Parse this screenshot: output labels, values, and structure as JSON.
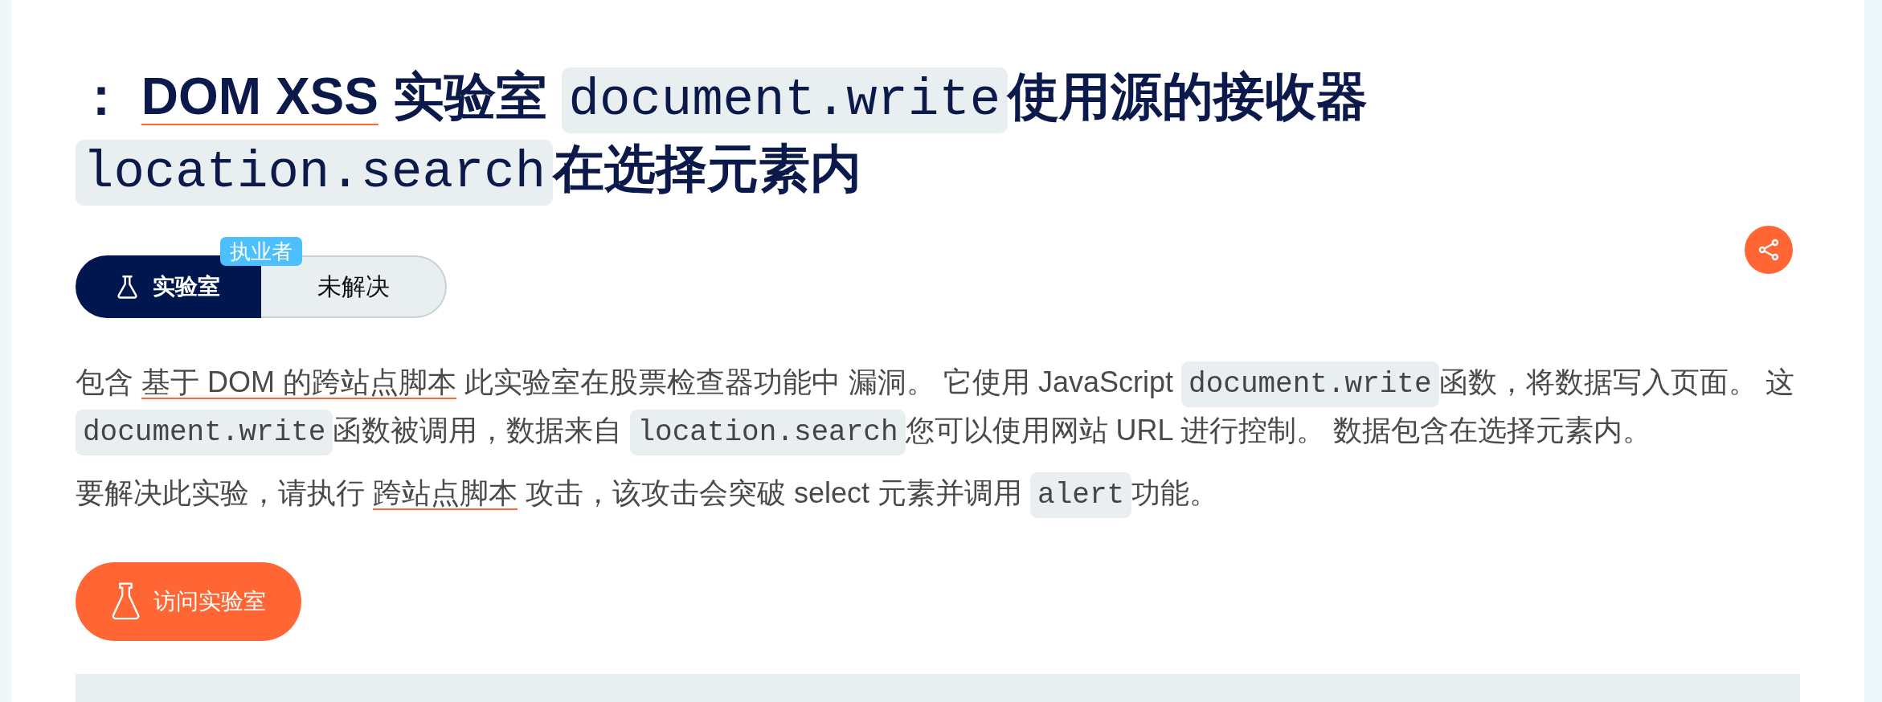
{
  "title": {
    "runs": [
      {
        "kind": "text",
        "text": "： "
      },
      {
        "kind": "link",
        "text": "DOM XSS"
      },
      {
        "kind": "text",
        "text": " 实验室 "
      },
      {
        "kind": "code",
        "text": "document.write"
      },
      {
        "kind": "text",
        "text": "使用源的接收器"
      },
      {
        "kind": "code",
        "text": "location.search"
      },
      {
        "kind": "text",
        "text": "在选择元素内"
      }
    ]
  },
  "lab_status": {
    "type_label": "实验室",
    "badge": "执业者",
    "status": "未解决"
  },
  "description": [
    {
      "runs": [
        {
          "kind": "text",
          "text": "包含 "
        },
        {
          "kind": "link",
          "text": "基于 DOM 的跨站点脚本"
        },
        {
          "kind": "text",
          "text": " 此实验室在股票检查器功能中 漏洞。 它使用 JavaScript "
        },
        {
          "kind": "code",
          "text": "document.write"
        },
        {
          "kind": "text",
          "text": "函数，将数据写入页面。 这 "
        },
        {
          "kind": "code",
          "text": "document.write"
        },
        {
          "kind": "text",
          "text": "函数被调用，数据来自 "
        },
        {
          "kind": "code",
          "text": "location.search"
        },
        {
          "kind": "text",
          "text": "您可以使用网站 URL 进行控制。 数据包含在选择元素内。"
        }
      ]
    },
    {
      "runs": [
        {
          "kind": "text",
          "text": "要解决此实验，请执行 "
        },
        {
          "kind": "link",
          "text": "跨站点脚本"
        },
        {
          "kind": "text",
          "text": " 攻击，该攻击会突破 select 元素并调用 "
        },
        {
          "kind": "code",
          "text": "alert"
        },
        {
          "kind": "text",
          "text": "功能。"
        }
      ]
    }
  ],
  "access_button": {
    "label": "访问实验室"
  }
}
